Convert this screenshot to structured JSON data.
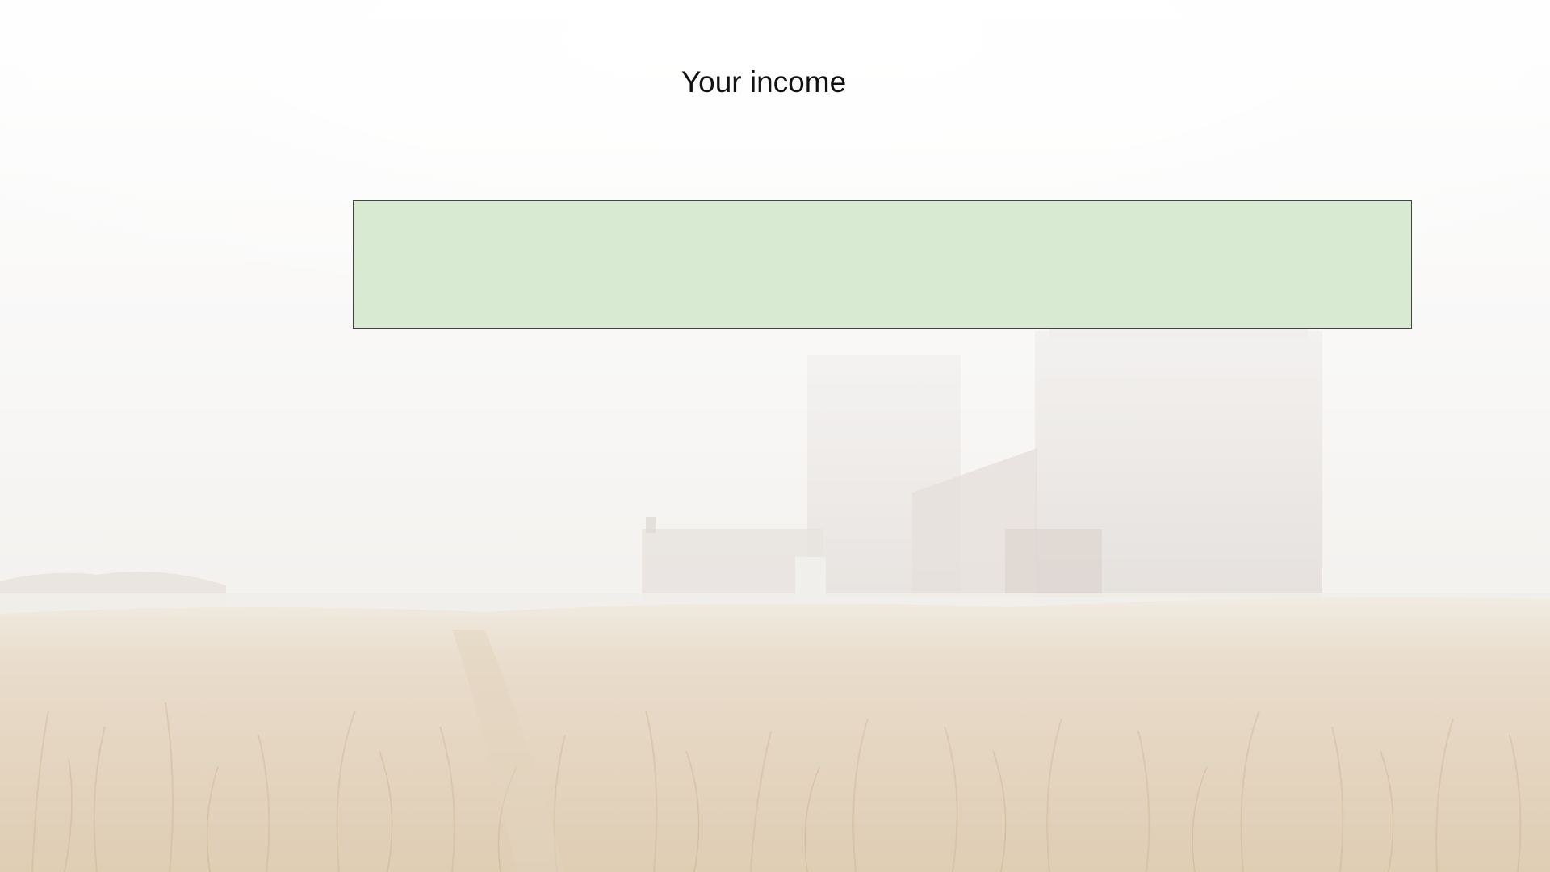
{
  "page": {
    "title": "Your income"
  },
  "colors": {
    "box_fill": "#d9ead3",
    "box_border": "#444444",
    "title_text": "#111111"
  },
  "background": {
    "icon": "foggy-field-with-barn-photo"
  }
}
